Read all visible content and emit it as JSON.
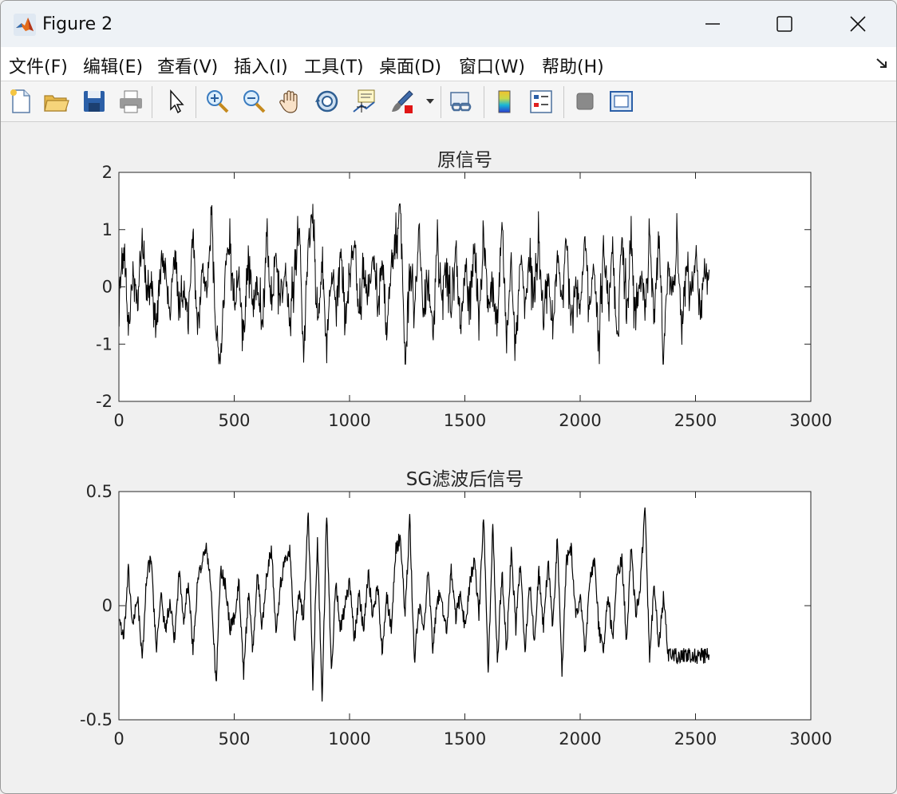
{
  "window": {
    "title": "Figure 2"
  },
  "menu": {
    "items": [
      "文件(F)",
      "编辑(E)",
      "查看(V)",
      "插入(I)",
      "工具(T)",
      "桌面(D)",
      "窗口(W)",
      "帮助(H)"
    ],
    "dock_icon": "dock-arrow-icon"
  },
  "toolbar": {
    "buttons": [
      "new-figure-icon",
      "open-file-icon",
      "save-icon",
      "print-icon",
      "edit-plot-icon",
      "zoom-in-icon",
      "zoom-out-icon",
      "pan-icon",
      "rotate-3d-icon",
      "data-cursor-icon",
      "brush-icon",
      "brush-dropdown-icon",
      "link-plot-icon",
      "colorbar-icon",
      "legend-icon",
      "hide-plot-tools-icon",
      "show-plot-tools-icon"
    ]
  },
  "chart_data": [
    {
      "type": "line",
      "title": "原信号",
      "xlabel": "",
      "ylabel": "",
      "xlim": [
        0,
        3000
      ],
      "ylim": [
        -2,
        2
      ],
      "xticks": [
        "0",
        "500",
        "1000",
        "1500",
        "2000",
        "2500",
        "3000"
      ],
      "yticks": [
        "2",
        "1",
        "0",
        "-1",
        "-2"
      ],
      "grid": false,
      "series": [
        {
          "color": "#000000",
          "n_points": 2560,
          "x_range": [
            1,
            2560
          ],
          "approx_std": 0.4,
          "min": -1.35,
          "max": 1.45,
          "y_approx_every_20": [
            0.0,
            0.6,
            -0.7,
            0.2,
            -0.4,
            0.9,
            -0.3,
            0.1,
            -0.8,
            0.5,
            0.3,
            -0.5,
            0.7,
            -0.2,
            0.0,
            -0.6,
            1.0,
            -0.9,
            0.4,
            -0.1,
            1.35,
            -0.8,
            -1.3,
            0.3,
            0.8,
            -0.5,
            0.2,
            -0.9,
            0.6,
            -0.3,
            0.1,
            -0.7,
            0.9,
            -0.4,
            0.5,
            -0.2,
            0.3,
            -0.6,
            0.2,
            1.1,
            -1.35,
            0.7,
            1.3,
            -0.8,
            0.4,
            -1.0,
            0.2,
            -0.3,
            0.6,
            -0.5,
            0.1,
            0.8,
            -0.6,
            0.3,
            -0.2,
            0.7,
            -0.4,
            0.5,
            -0.9,
            0.3,
            0.6,
            1.45,
            -1.25,
            0.4,
            -0.3,
            0.9,
            -0.6,
            0.2,
            -0.8,
            0.7,
            -0.2,
            0.5,
            -0.4,
            0.8,
            -0.7,
            0.3,
            -0.1,
            0.6,
            -0.5,
            0.9,
            -0.3,
            0.2,
            -0.6,
            1.2,
            -0.9,
            0.4,
            -1.2,
            0.7,
            -0.4,
            0.5,
            -0.2,
            0.8,
            -0.6,
            0.3,
            -0.8,
            0.6,
            -0.3,
            0.9,
            -0.7,
            0.2,
            -0.4,
            1.0,
            -0.5,
            0.4,
            -0.9,
            0.6,
            -0.3,
            0.7,
            -1.1,
            1.0,
            -0.5,
            0.8,
            -0.7,
            0.3,
            -0.4,
            0.9,
            -0.6,
            1.1,
            -1.35,
            0.5,
            -0.3,
            0.7,
            -0.8,
            0.4,
            -0.2,
            0.5,
            -0.4,
            0.3
          ]
        }
      ]
    },
    {
      "type": "line",
      "title": "SG滤波后信号",
      "xlabel": "",
      "ylabel": "",
      "xlim": [
        0,
        3000
      ],
      "ylim": [
        -0.5,
        0.5
      ],
      "xticks": [
        "0",
        "500",
        "1000",
        "1500",
        "2000",
        "2500",
        "3000"
      ],
      "yticks": [
        "0.5",
        "0",
        "-0.5"
      ],
      "grid": false,
      "series": [
        {
          "color": "#000000",
          "n_points": 2560,
          "x_range": [
            1,
            2560
          ],
          "y_approx_every_20": [
            -0.05,
            -0.15,
            0.15,
            -0.1,
            0.05,
            -0.25,
            0.15,
            0.2,
            -0.2,
            0.05,
            -0.1,
            0.0,
            -0.15,
            0.15,
            -0.05,
            0.1,
            -0.2,
            0.1,
            0.2,
            0.25,
            0.05,
            -0.35,
            0.15,
            0.1,
            -0.1,
            -0.05,
            0.1,
            -0.3,
            0.05,
            -0.2,
            0.15,
            -0.1,
            0.15,
            0.25,
            -0.1,
            0.1,
            0.2,
            0.25,
            -0.15,
            0.05,
            -0.05,
            0.42,
            -0.35,
            0.3,
            -0.42,
            0.42,
            -0.3,
            0.1,
            -0.1,
            0.0,
            0.1,
            -0.15,
            0.05,
            -0.1,
            0.15,
            -0.05,
            0.1,
            -0.2,
            0.05,
            -0.1,
            0.25,
            0.3,
            -0.05,
            0.38,
            -0.25,
            0.0,
            -0.1,
            0.15,
            -0.2,
            0.05,
            0.0,
            -0.1,
            0.15,
            -0.05,
            0.05,
            -0.1,
            0.1,
            0.2,
            -0.05,
            0.4,
            -0.3,
            0.35,
            -0.25,
            0.15,
            -0.2,
            0.25,
            -0.1,
            0.2,
            -0.2,
            0.1,
            -0.15,
            0.15,
            -0.1,
            0.2,
            -0.1,
            0.3,
            -0.3,
            0.2,
            0.25,
            -0.05,
            0.05,
            -0.2,
            0.1,
            0.2,
            -0.1,
            -0.2,
            0.05,
            -0.15,
            0.15,
            0.2,
            -0.15,
            0.25,
            -0.05,
            0.1,
            0.43,
            -0.25,
            0.1,
            -0.2,
            0.05,
            -0.22
          ]
        }
      ]
    }
  ]
}
